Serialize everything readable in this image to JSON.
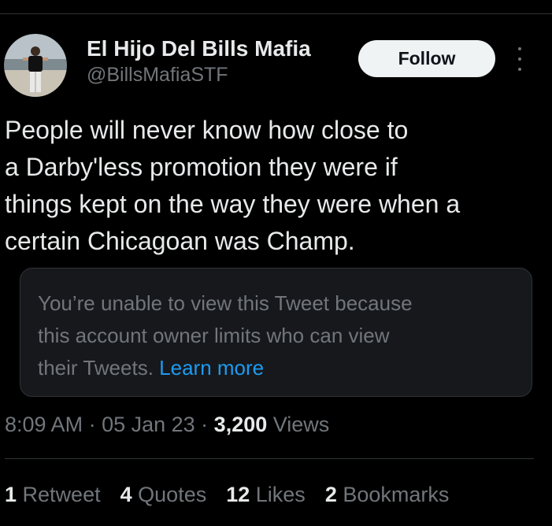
{
  "author": {
    "display_name": "El Hijo Del Bills Mafia",
    "handle": "@BillsMafiaSTF",
    "avatar_icon": "profile-photo-beach"
  },
  "follow_label": "Follow",
  "more_icon": "vertical-ellipsis-icon",
  "tweet": {
    "text_lines": [
      "People will never know how close to",
      "a Darby'less promotion they were if",
      "things kept on the way they were when a",
      "certain Chicagoan was Champ."
    ]
  },
  "unavailable_card": {
    "message_lines": [
      "You’re unable to view this Tweet because",
      "this account owner limits who can view",
      "their Tweets."
    ],
    "link_label": "Learn more"
  },
  "meta": {
    "time": "8:09 AM",
    "separator": " · ",
    "date": "05 Jan 23",
    "views_count": "3,200",
    "views_label": "Views"
  },
  "stats": [
    {
      "count": "1",
      "label": "Retweet"
    },
    {
      "count": "4",
      "label": "Quotes"
    },
    {
      "count": "12",
      "label": "Likes"
    },
    {
      "count": "2",
      "label": "Bookmarks"
    }
  ],
  "colors": {
    "background": "#000000",
    "text_primary": "#e7e9ea",
    "text_secondary": "#71767b",
    "link": "#1d9bf0",
    "card_background": "#16181c",
    "divider": "#2f3336",
    "follow_button_bg": "#eff3f4"
  }
}
